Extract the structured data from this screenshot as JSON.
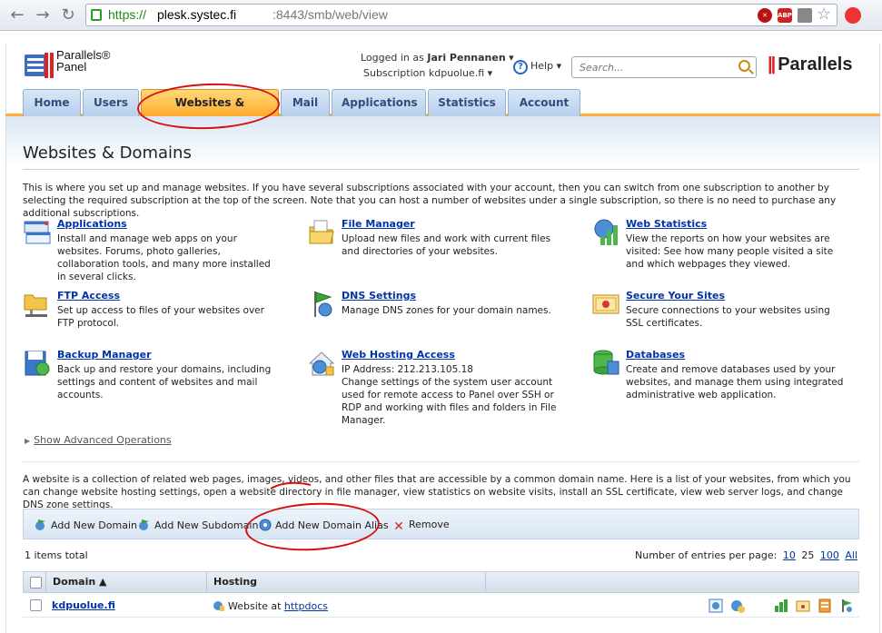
{
  "browser": {
    "url_scheme": "https://",
    "url_host": "plesk.systec.fi",
    "url_rest": ":8443/smb/web/view",
    "abp_label": "ABP"
  },
  "header": {
    "logo_line1": "Parallels®",
    "logo_line2": "Panel",
    "logged_in_prefix": "Logged in as",
    "user_name": "Jari Pennanen",
    "subscription_prefix": "Subscription",
    "subscription_name": "kdpuolue.fi",
    "help_label": "Help",
    "search_placeholder": "Search...",
    "brand": "Parallels"
  },
  "tabs": [
    {
      "label": "Home"
    },
    {
      "label": "Users"
    },
    {
      "label": "Websites & Domains"
    },
    {
      "label": "Mail"
    },
    {
      "label": "Applications"
    },
    {
      "label": "Statistics"
    },
    {
      "label": "Account"
    }
  ],
  "page": {
    "title": "Websites & Domains",
    "intro": "This is where you set up and manage websites. If you have several subscriptions associated with your account, then you can switch from one subscription to another by selecting the required subscription at the top of the screen. Note that you can host a number of websites under a single subscription, so there is no need to purchase any additional subscriptions."
  },
  "features": [
    {
      "title": "Applications",
      "desc": "Install and manage web apps on your websites. Forums, photo galleries, collaboration tools, and many more installed in several clicks."
    },
    {
      "title": "File Manager",
      "desc": "Upload new files and work with current files and directories of your websites."
    },
    {
      "title": "Web Statistics",
      "desc": "View the reports on how your websites are visited: See how many people visited a site and which webpages they viewed."
    },
    {
      "title": "FTP Access",
      "desc": "Set up access to files of your websites over FTP protocol."
    },
    {
      "title": "DNS Settings",
      "desc": "Manage DNS zones for your domain names."
    },
    {
      "title": "Secure Your Sites",
      "desc": "Secure connections to your websites using SSL certificates."
    },
    {
      "title": "Backup Manager",
      "desc": "Back up and restore your domains, including settings and content of websites and mail accounts."
    },
    {
      "title": "Web Hosting Access",
      "desc": "IP Address: 212.213.105.18\nChange settings of the system user account used for remote access to Panel over SSH or RDP and working with files and folders in File Manager."
    },
    {
      "title": "Databases",
      "desc": "Create and remove databases used by your websites, and manage them using integrated administrative web application."
    }
  ],
  "advanced": {
    "label": "Show Advanced Operations"
  },
  "websites": {
    "desc": "A website is a collection of related web pages, images, videos, and other files that are accessible by a common domain name. Here is a list of your websites, from which you can change website hosting settings, open a website directory in file manager, view statistics on website visits, install an SSL certificate, view web server logs, and change DNS zone settings.",
    "toolbar": [
      {
        "label": "Add New Domain"
      },
      {
        "label": "Add New Subdomain"
      },
      {
        "label": "Add New Domain Alias"
      },
      {
        "label": "Remove"
      }
    ],
    "items_total": "1 items total",
    "per_page_label": "Number of entries per page:",
    "per_page_options": [
      "10",
      "25",
      "100",
      "All"
    ],
    "columns": {
      "domain": "Domain ▲",
      "hosting": "Hosting"
    },
    "rows": [
      {
        "domain": "kdpuolue.fi",
        "hosting_prefix": "Website at",
        "hosting_link": "httpdocs"
      }
    ]
  },
  "colors": {
    "tab_active": "#ffac2e",
    "link": "#0033aa",
    "annotation": "#d61010"
  }
}
